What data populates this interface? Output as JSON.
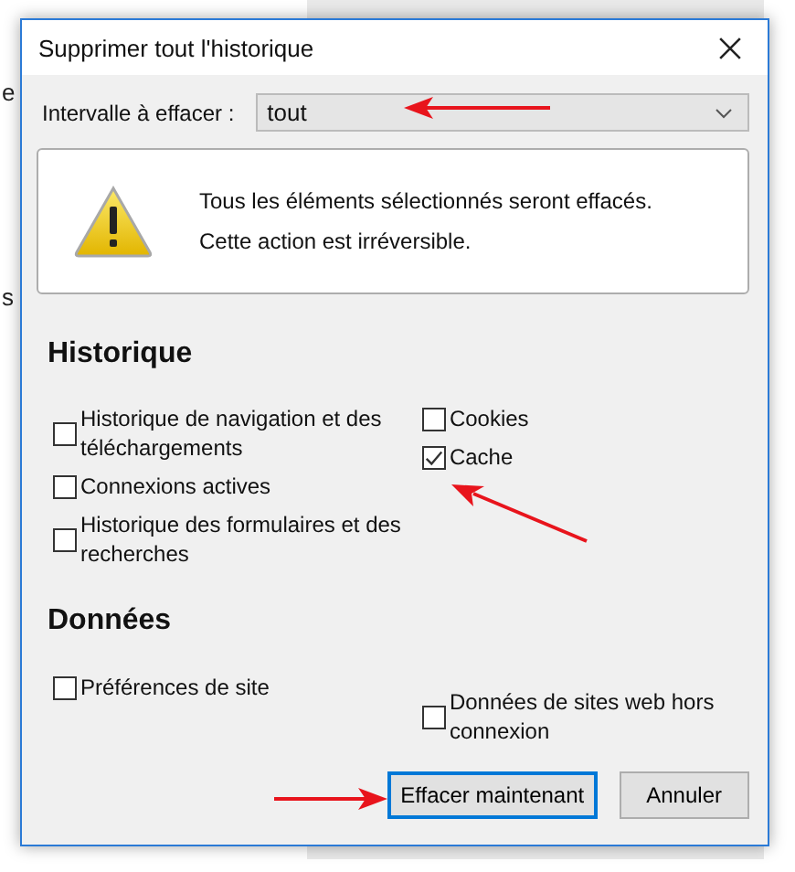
{
  "background": {
    "fragments": [
      "e",
      "s"
    ]
  },
  "window": {
    "title": "Supprimer tout l'historique"
  },
  "range": {
    "label": "Intervalle à effacer :",
    "value": "tout"
  },
  "warning": {
    "lines": [
      "Tous les éléments sélectionnés seront effacés.",
      "Cette action est irréversible."
    ]
  },
  "history": {
    "heading": "Historique",
    "left": [
      {
        "label": "Historique de navigation et des téléchargements",
        "checked": false
      },
      {
        "label": "Connexions actives",
        "checked": false
      },
      {
        "label": "Historique des formulaires et des recherches",
        "checked": false
      }
    ],
    "right": [
      {
        "label": "Cookies",
        "checked": false
      },
      {
        "label": "Cache",
        "checked": true
      }
    ]
  },
  "data": {
    "heading": "Données",
    "items": [
      {
        "label": "Préférences de site",
        "checked": false
      },
      {
        "label": "Données de sites web hors connexion",
        "checked": false
      }
    ]
  },
  "buttons": [
    {
      "label": "Effacer maintenant",
      "kind": "primary"
    },
    {
      "label": "Annuler",
      "kind": "secondary"
    }
  ]
}
